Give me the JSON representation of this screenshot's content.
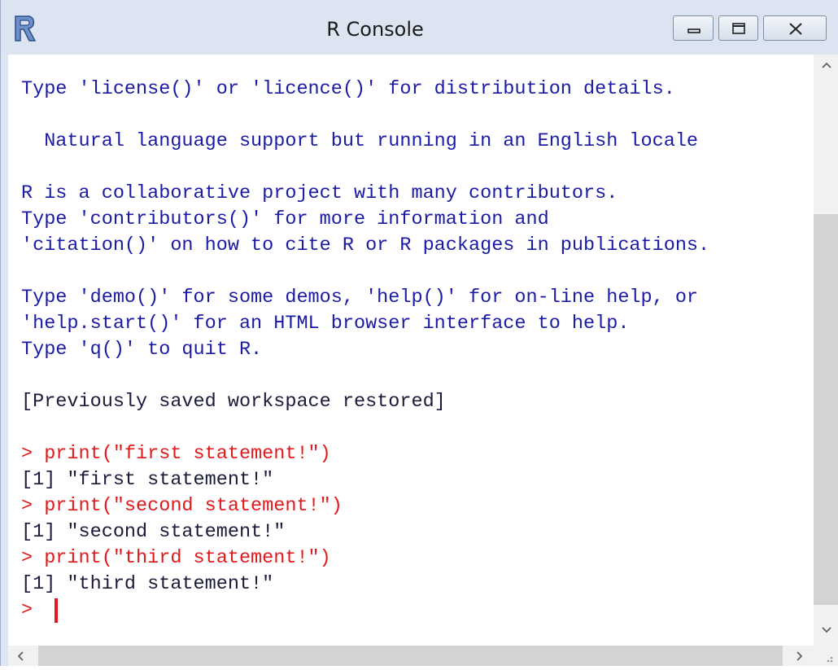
{
  "window": {
    "title": "R Console",
    "icons": {
      "app": "r-logo-icon",
      "minimize": "minimize-icon",
      "maximize": "maximize-icon",
      "close": "close-icon"
    }
  },
  "console": {
    "lines": [
      {
        "text": "Type 'license()' or 'licence()' for distribution details.",
        "kind": "info"
      },
      {
        "text": "  Natural language support but running in an English locale",
        "kind": "info"
      },
      {
        "text": "R is a collaborative project with many contributors.",
        "kind": "info"
      },
      {
        "text": "Type 'contributors()' for more information and",
        "kind": "info"
      },
      {
        "text": "'citation()' on how to cite R or R packages in publications.",
        "kind": "info"
      },
      {
        "text": "Type 'demo()' for some demos, 'help()' for on-line help, or",
        "kind": "info"
      },
      {
        "text": "'help.start()' for an HTML browser interface to help.",
        "kind": "info"
      },
      {
        "text": "Type 'q()' to quit R.",
        "kind": "info"
      },
      {
        "text": "[Previously saved workspace restored]",
        "kind": "output"
      },
      {
        "text": "> print(\"first statement!\")",
        "kind": "input"
      },
      {
        "text": "[1] \"first statement!\"",
        "kind": "output"
      },
      {
        "text": "> print(\"second statement!\")",
        "kind": "input"
      },
      {
        "text": "[1] \"second statement!\"",
        "kind": "output"
      },
      {
        "text": "> print(\"third statement!\")",
        "kind": "input"
      },
      {
        "text": "[1] \"third statement!\"",
        "kind": "output"
      }
    ],
    "prompt": ">"
  },
  "colors": {
    "info_text": "#1a1aa6",
    "output_text": "#1a1a3a",
    "input_text": "#e0191c",
    "cursor": "#e0191c"
  }
}
